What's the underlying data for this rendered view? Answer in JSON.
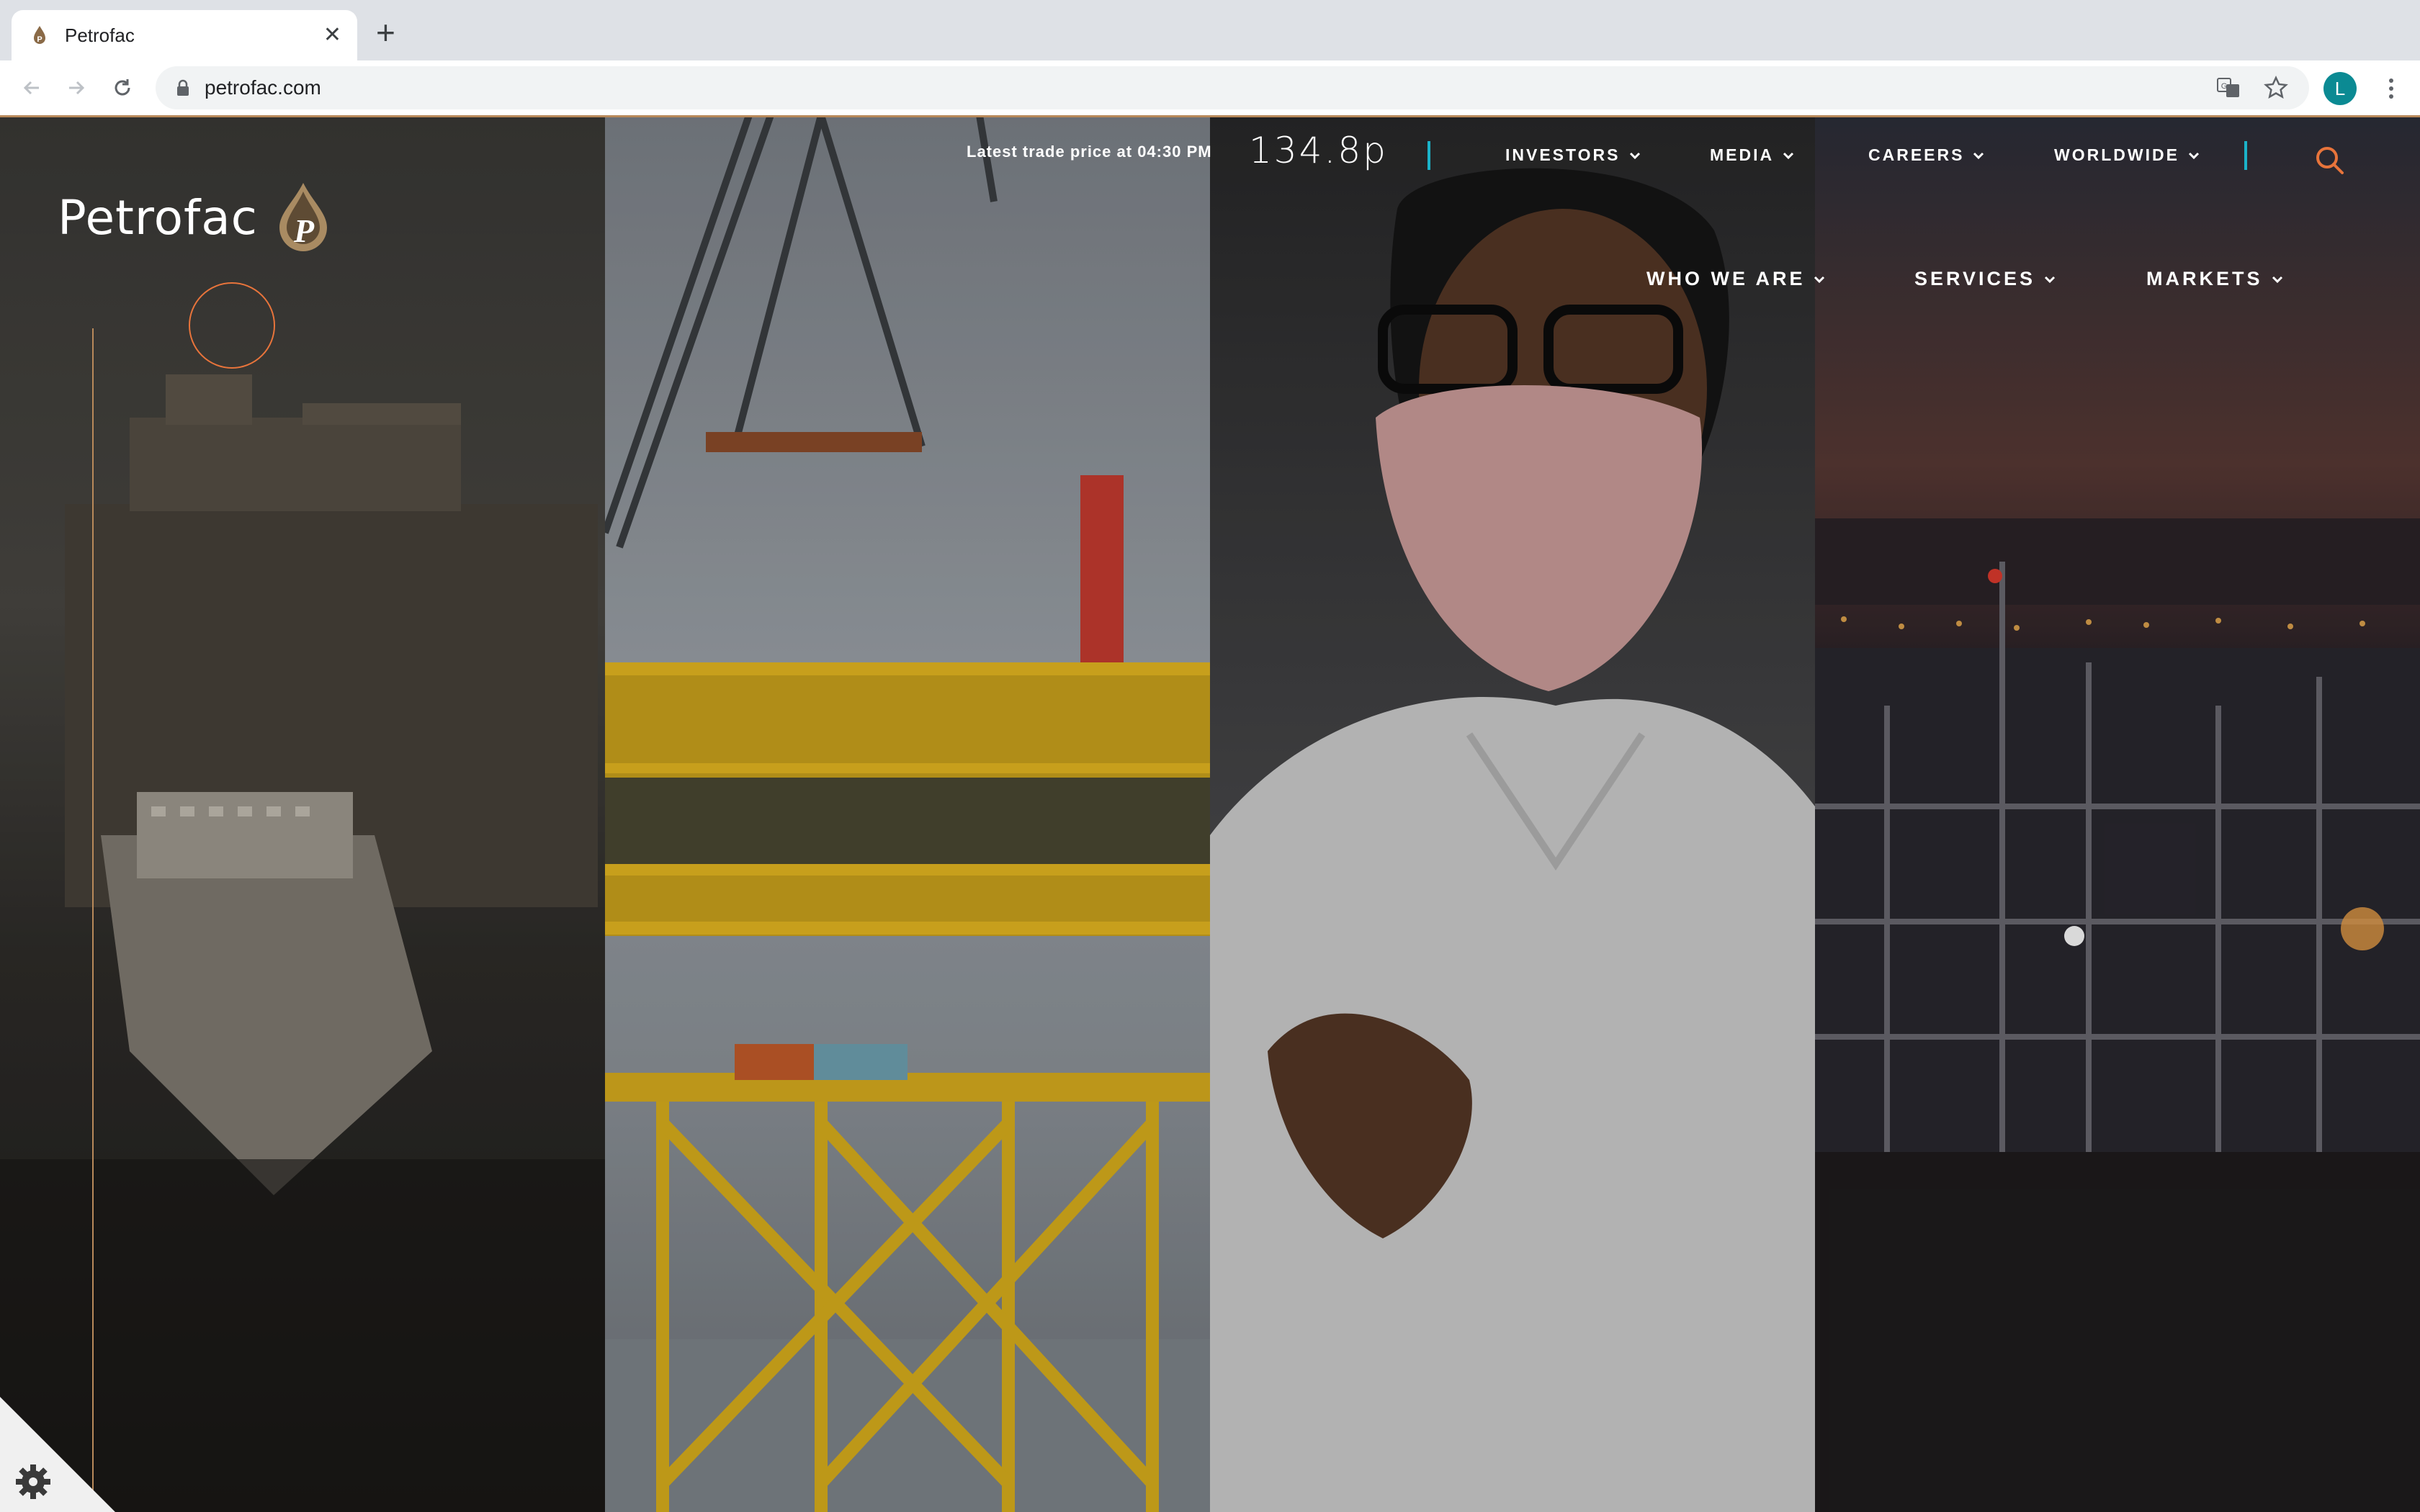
{
  "browser": {
    "tab_title": "Petrofac",
    "new_tab": "+",
    "url": "petrofac.com",
    "profile_initial": "L"
  },
  "site": {
    "logo_text": "Petrofac",
    "trade_label": "Latest trade price at 04:30 PM",
    "trade_price": "134.8p",
    "utility_nav": [
      {
        "label": "INVESTORS"
      },
      {
        "label": "MEDIA"
      },
      {
        "label": "CAREERS"
      },
      {
        "label": "WORLDWIDE"
      }
    ],
    "main_nav": [
      {
        "label": "WHO WE ARE"
      },
      {
        "label": "SERVICES"
      },
      {
        "label": "MARKETS"
      }
    ],
    "colors": {
      "accent_orange": "#e8743b",
      "accent_teal": "#1bb3c9",
      "gold": "#b8895a"
    }
  }
}
